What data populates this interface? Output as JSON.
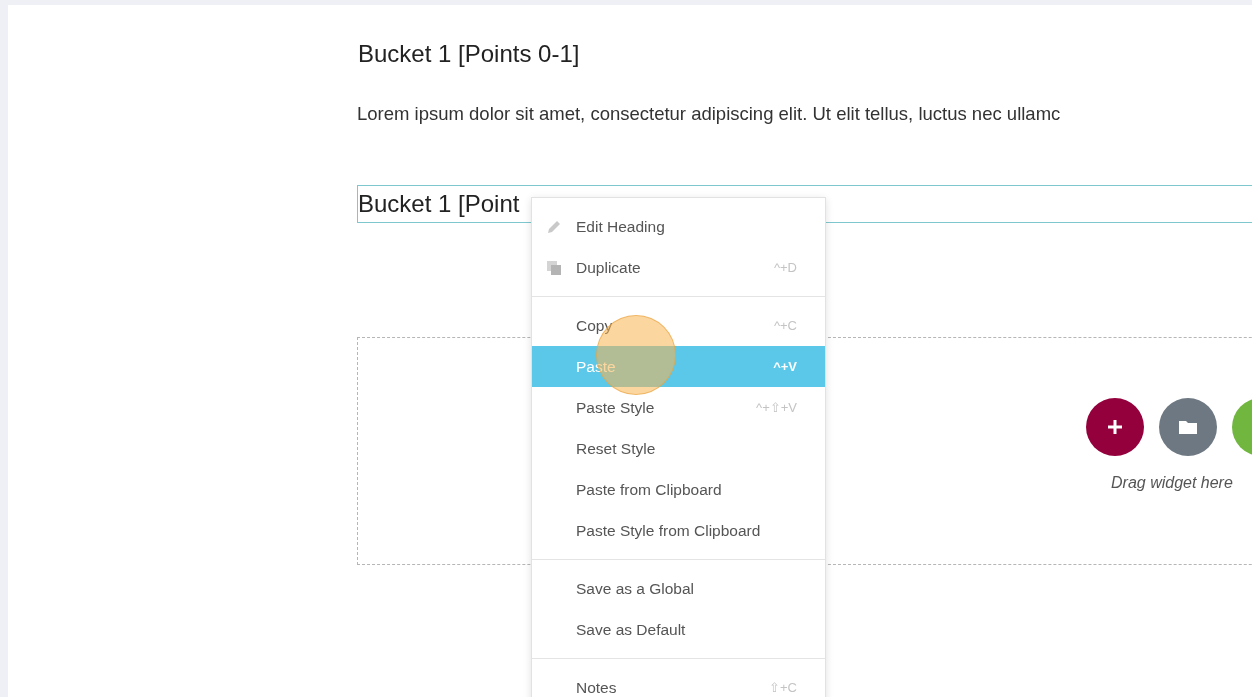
{
  "headings": [
    {
      "text": "Bucket 1 [Points 0-1]",
      "selected": false
    }
  ],
  "paragraph": "Lorem ipsum dolor sit amet, consectetur adipiscing elit. Ut elit tellus, luctus nec ullamc",
  "selected_heading": {
    "text": "Bucket 1 [Point",
    "selected": true
  },
  "drop_zone": {
    "buttons": [
      {
        "kind": "add",
        "color": "#93003c"
      },
      {
        "kind": "folder",
        "color": "#6d7882"
      },
      {
        "kind": "other",
        "color": "#71b73f"
      }
    ],
    "hint": "Drag widget here"
  },
  "context_menu": {
    "groups": [
      [
        {
          "kind": "edit",
          "label": "Edit Heading",
          "selected": false
        },
        {
          "kind": "duplicate",
          "label": "Duplicate",
          "shortcut": "^+D",
          "selected": false
        }
      ],
      [
        {
          "kind": "plain",
          "label": "Copy",
          "shortcut": "^+C",
          "selected": false
        },
        {
          "kind": "plain",
          "label": "Paste",
          "shortcut": "^+V",
          "selected": true
        },
        {
          "kind": "plain",
          "label": "Paste Style",
          "shortcut": "^+⇧+V",
          "selected": false
        },
        {
          "kind": "plain",
          "label": "Reset Style",
          "selected": false
        },
        {
          "kind": "plain",
          "label": "Paste from Clipboard",
          "selected": false
        },
        {
          "kind": "plain",
          "label": "Paste Style from Clipboard",
          "selected": false
        }
      ],
      [
        {
          "kind": "plain",
          "label": "Save as a Global",
          "selected": false
        },
        {
          "kind": "plain",
          "label": "Save as Default",
          "selected": false
        }
      ],
      [
        {
          "kind": "plain",
          "label": "Notes",
          "shortcut": "⇧+C",
          "selected": false
        }
      ]
    ]
  }
}
